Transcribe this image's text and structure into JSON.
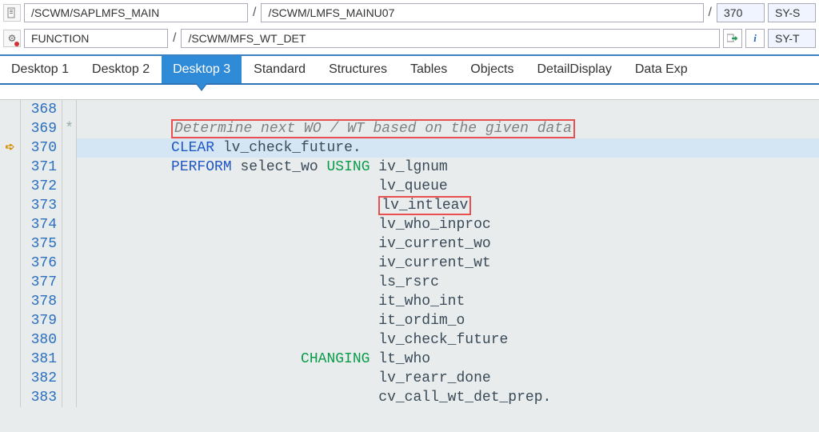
{
  "toolbar1": {
    "path1": "/SCWM/SAPLMFS_MAIN",
    "sep": "/",
    "path2": "/SCWM/LMFS_MAINU07",
    "line_no": "370",
    "sy1": "SY-S"
  },
  "toolbar2": {
    "object_type": "FUNCTION",
    "sep": "/",
    "object_name": "/SCWM/MFS_WT_DET",
    "sy2": "SY-T"
  },
  "tabs": [
    {
      "label": "Desktop 1",
      "active": false
    },
    {
      "label": "Desktop 2",
      "active": false
    },
    {
      "label": "Desktop 3",
      "active": true
    },
    {
      "label": "Standard",
      "active": false
    },
    {
      "label": "Structures",
      "active": false
    },
    {
      "label": "Tables",
      "active": false
    },
    {
      "label": "Objects",
      "active": false
    },
    {
      "label": "DetailDisplay",
      "active": false
    },
    {
      "label": "Data Exp",
      "active": false
    }
  ],
  "code": {
    "lines": [
      {
        "n": 368,
        "mk": "",
        "segs": []
      },
      {
        "n": 369,
        "mk": "*",
        "segs": [
          {
            "cls": "comment hl-red-box",
            "t": "Determine next WO / WT based on the given data",
            "indent": "          "
          }
        ]
      },
      {
        "n": 370,
        "mk": "",
        "current": true,
        "brk": "arrow",
        "segs": [
          {
            "indent": "          "
          },
          {
            "cls": "kw-blue",
            "t": "CLEAR "
          },
          {
            "cls": "ident",
            "t": "lv_check_future"
          },
          {
            "cls": "ident",
            "t": "."
          }
        ]
      },
      {
        "n": 371,
        "mk": "",
        "segs": [
          {
            "indent": "          "
          },
          {
            "cls": "kw-blue",
            "t": "PERFORM "
          },
          {
            "cls": "ident",
            "t": "select_wo "
          },
          {
            "cls": "kw-green",
            "t": "USING "
          },
          {
            "cls": "ident",
            "t": "iv_lgnum"
          }
        ]
      },
      {
        "n": 372,
        "mk": "",
        "segs": [
          {
            "indent": "                                  "
          },
          {
            "cls": "ident",
            "t": "lv_queue"
          }
        ]
      },
      {
        "n": 373,
        "mk": "",
        "segs": [
          {
            "indent": "                                  "
          },
          {
            "cls": "ident hl-red-box",
            "t": "lv_intleav"
          }
        ]
      },
      {
        "n": 374,
        "mk": "",
        "segs": [
          {
            "indent": "                                  "
          },
          {
            "cls": "ident",
            "t": "lv_who_inproc"
          }
        ]
      },
      {
        "n": 375,
        "mk": "",
        "segs": [
          {
            "indent": "                                  "
          },
          {
            "cls": "ident",
            "t": "iv_current_wo"
          }
        ]
      },
      {
        "n": 376,
        "mk": "",
        "segs": [
          {
            "indent": "                                  "
          },
          {
            "cls": "ident",
            "t": "iv_current_wt"
          }
        ]
      },
      {
        "n": 377,
        "mk": "",
        "segs": [
          {
            "indent": "                                  "
          },
          {
            "cls": "ident",
            "t": "ls_rsrc"
          }
        ]
      },
      {
        "n": 378,
        "mk": "",
        "segs": [
          {
            "indent": "                                  "
          },
          {
            "cls": "ident",
            "t": "it_who_int"
          }
        ]
      },
      {
        "n": 379,
        "mk": "",
        "segs": [
          {
            "indent": "                                  "
          },
          {
            "cls": "ident",
            "t": "it_ordim_o"
          }
        ]
      },
      {
        "n": 380,
        "mk": "",
        "segs": [
          {
            "indent": "                                  "
          },
          {
            "cls": "ident",
            "t": "lv_check_future"
          }
        ]
      },
      {
        "n": 381,
        "mk": "",
        "segs": [
          {
            "indent": "                         "
          },
          {
            "cls": "kw-green",
            "t": "CHANGING "
          },
          {
            "cls": "ident",
            "t": "lt_who"
          }
        ]
      },
      {
        "n": 382,
        "mk": "",
        "segs": [
          {
            "indent": "                                  "
          },
          {
            "cls": "ident",
            "t": "lv_rearr_done"
          }
        ]
      },
      {
        "n": 383,
        "mk": "",
        "segs": [
          {
            "indent": "                                  "
          },
          {
            "cls": "ident",
            "t": "cv_call_wt_det_prep"
          },
          {
            "cls": "ident",
            "t": "."
          }
        ]
      }
    ]
  }
}
